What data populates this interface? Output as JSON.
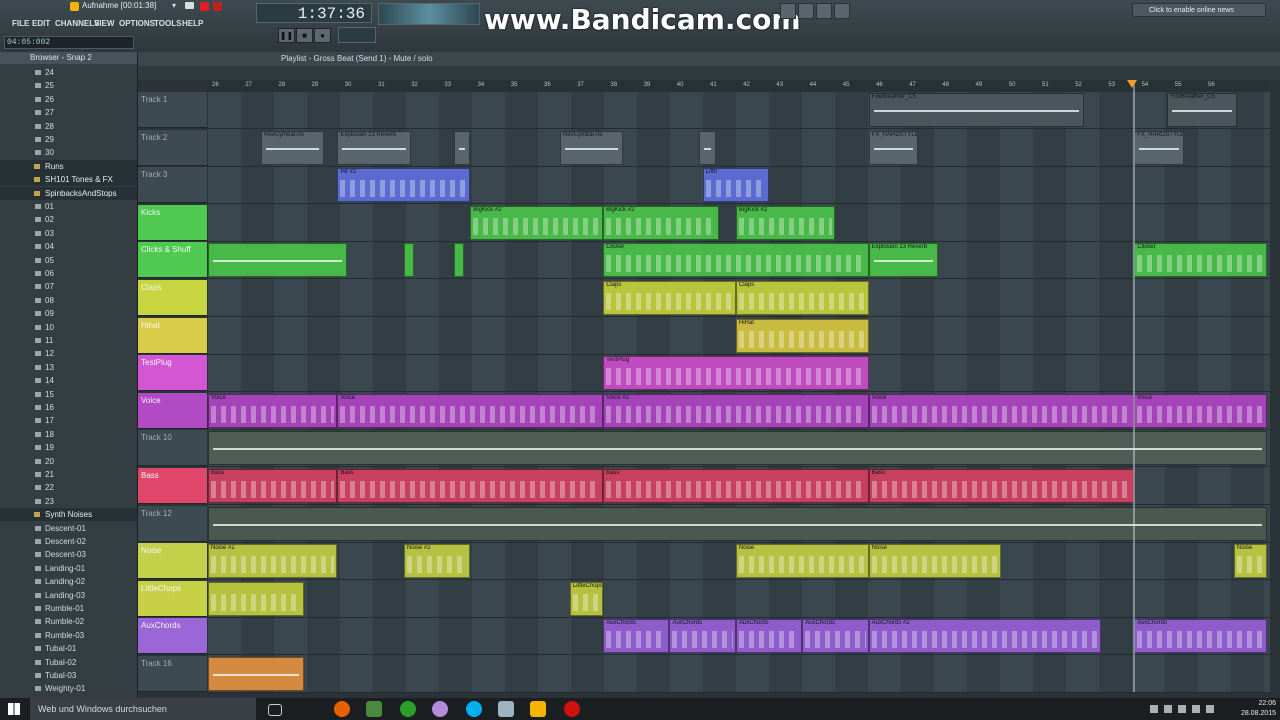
{
  "recording_title": "Aufnahme [00:01:38]",
  "menu": [
    "FILE",
    "EDIT",
    "CHANNELS",
    "VIEW",
    "OPTIONS",
    "TOOLS",
    "HELP"
  ],
  "hint_value": "04:05:002",
  "time_display": "1:37:36",
  "watermark": "www.Bandicam.com",
  "online_news": "Click to enable online news",
  "browser": {
    "title": "Browser - Snap 2",
    "items": [
      {
        "label": "24",
        "folder": false
      },
      {
        "label": "25",
        "folder": false
      },
      {
        "label": "26",
        "folder": false
      },
      {
        "label": "27",
        "folder": false
      },
      {
        "label": "28",
        "folder": false
      },
      {
        "label": "29",
        "folder": false
      },
      {
        "label": "30",
        "folder": false
      },
      {
        "label": "Runs",
        "folder": true
      },
      {
        "label": "SH101 Tones & FX",
        "folder": true
      },
      {
        "label": "SpinbacksAndStops",
        "folder": true
      },
      {
        "label": "01",
        "folder": false
      },
      {
        "label": "02",
        "folder": false
      },
      {
        "label": "03",
        "folder": false
      },
      {
        "label": "04",
        "folder": false
      },
      {
        "label": "05",
        "folder": false
      },
      {
        "label": "06",
        "folder": false
      },
      {
        "label": "07",
        "folder": false
      },
      {
        "label": "08",
        "folder": false
      },
      {
        "label": "09",
        "folder": false
      },
      {
        "label": "10",
        "folder": false
      },
      {
        "label": "11",
        "folder": false
      },
      {
        "label": "12",
        "folder": false
      },
      {
        "label": "13",
        "folder": false
      },
      {
        "label": "14",
        "folder": false
      },
      {
        "label": "15",
        "folder": false
      },
      {
        "label": "16",
        "folder": false
      },
      {
        "label": "17",
        "folder": false
      },
      {
        "label": "18",
        "folder": false
      },
      {
        "label": "19",
        "folder": false
      },
      {
        "label": "20",
        "folder": false
      },
      {
        "label": "21",
        "folder": false
      },
      {
        "label": "22",
        "folder": false
      },
      {
        "label": "23",
        "folder": false
      },
      {
        "label": "Synth Noises",
        "folder": true
      },
      {
        "label": "Descent-01",
        "folder": false
      },
      {
        "label": "Descent-02",
        "folder": false
      },
      {
        "label": "Descent-03",
        "folder": false
      },
      {
        "label": "Landing-01",
        "folder": false
      },
      {
        "label": "Landing-02",
        "folder": false
      },
      {
        "label": "Landing-03",
        "folder": false
      },
      {
        "label": "Rumble-01",
        "folder": false
      },
      {
        "label": "Rumble-02",
        "folder": false
      },
      {
        "label": "Rumble-03",
        "folder": false
      },
      {
        "label": "Tubal-01",
        "folder": false
      },
      {
        "label": "Tubal-02",
        "folder": false
      },
      {
        "label": "Tubal-03",
        "folder": false
      },
      {
        "label": "Weighty-01",
        "folder": false
      }
    ]
  },
  "playlist_title": "Playlist - Gross Beat (Send 1) - Mute / solo",
  "ruler": [
    "26",
    "27",
    "28",
    "29",
    "30",
    "31",
    "32",
    "33",
    "34",
    "35",
    "36",
    "37",
    "38",
    "39",
    "40",
    "41",
    "42",
    "43",
    "44",
    "45",
    "46",
    "47",
    "48",
    "49",
    "50",
    "51",
    "52",
    "53",
    "54",
    "55",
    "56"
  ],
  "tracks": [
    {
      "name": "Track 1",
      "color": "#3d4a51",
      "clips": [
        {
          "s": 19.9,
          "e": 26.4,
          "label": "FireBreather_C5",
          "c": "#4a565c",
          "k": "auto"
        },
        {
          "s": 28.9,
          "e": 31.0,
          "label": "FireBreather_C5",
          "c": "#4a565c",
          "k": "auto"
        }
      ]
    },
    {
      "name": "Track 2",
      "color": "#3d4a51",
      "clips": [
        {
          "s": 1.6,
          "e": 3.5,
          "label": "RevCymbal-05",
          "c": "#59656c",
          "k": "wave"
        },
        {
          "s": 3.9,
          "e": 6.1,
          "label": "Explosion 13 Reverb",
          "c": "#59656c",
          "k": "wave"
        },
        {
          "s": 7.4,
          "e": 7.9,
          "label": "",
          "c": "#59656c",
          "k": "wave"
        },
        {
          "s": 10.6,
          "e": 12.5,
          "label": "RevCymbal-05",
          "c": "#59656c",
          "k": "wave"
        },
        {
          "s": 14.8,
          "e": 15.3,
          "label": "",
          "c": "#59656c",
          "k": "wave"
        },
        {
          "s": 19.9,
          "e": 21.4,
          "label": "FX_HARDSTYLE",
          "c": "#59656c",
          "k": "wave"
        },
        {
          "s": 27.9,
          "e": 29.4,
          "label": "FX_HARDSTYLE",
          "c": "#59656c",
          "k": "wave"
        }
      ]
    },
    {
      "name": "Track 3",
      "color": "#3d4a51",
      "clips": [
        {
          "s": 3.9,
          "e": 7.9,
          "label": "Hit #2",
          "c": "#5b6bcf",
          "k": "notes"
        },
        {
          "s": 14.9,
          "e": 16.9,
          "label": "Liftfr",
          "c": "#5b6bcf",
          "k": "notes"
        }
      ]
    },
    {
      "name": "Kicks",
      "color": "#4fc94f",
      "clips": [
        {
          "s": 7.9,
          "e": 11.9,
          "label": "BigKick #2",
          "c": "#48b848",
          "k": "notes"
        },
        {
          "s": 11.9,
          "e": 15.4,
          "label": "BigKick #2",
          "c": "#48b848",
          "k": "notes"
        },
        {
          "s": 15.9,
          "e": 18.9,
          "label": "BigKick #2",
          "c": "#48b848",
          "k": "notes"
        }
      ]
    },
    {
      "name": "Clicks & Shuff",
      "color": "#4fc94f",
      "clips": [
        {
          "s": 0,
          "e": 4.2,
          "label": "",
          "c": "#48b848",
          "k": "wave"
        },
        {
          "s": 5.9,
          "e": 6.2,
          "label": "",
          "c": "#48b848",
          "k": "wave"
        },
        {
          "s": 7.4,
          "e": 7.7,
          "label": "",
          "c": "#48b848",
          "k": "wave"
        },
        {
          "s": 11.9,
          "e": 19.9,
          "label": "Clicker",
          "c": "#48b848",
          "k": "notes"
        },
        {
          "s": 19.9,
          "e": 22.0,
          "label": "Explosion 13 Reverb",
          "c": "#48b848",
          "k": "wave"
        },
        {
          "s": 27.9,
          "e": 31.9,
          "label": "Clicker",
          "c": "#48b848",
          "k": "notes"
        }
      ]
    },
    {
      "name": "Claps",
      "color": "#c7d541",
      "clips": [
        {
          "s": 11.9,
          "e": 15.9,
          "label": "Claps",
          "c": "#b8c43c",
          "k": "notes"
        },
        {
          "s": 15.9,
          "e": 19.9,
          "label": "Claps",
          "c": "#b8c43c",
          "k": "notes"
        }
      ]
    },
    {
      "name": "Hihat",
      "color": "#d9cc48",
      "clips": [
        {
          "s": 15.9,
          "e": 19.9,
          "label": "HiHat",
          "c": "#c8bb40",
          "k": "notes"
        }
      ]
    },
    {
      "name": "TestPlug",
      "color": "#d356d3",
      "clips": [
        {
          "s": 11.9,
          "e": 19.9,
          "label": "TestPlug",
          "c": "#bf4cbf",
          "k": "notes"
        }
      ]
    },
    {
      "name": "Voice",
      "color": "#b24ac6",
      "clips": [
        {
          "s": 0,
          "e": 3.9,
          "label": "Voice",
          "c": "#a444b8",
          "k": "notes"
        },
        {
          "s": 3.9,
          "e": 11.9,
          "label": "Voice",
          "c": "#a444b8",
          "k": "notes"
        },
        {
          "s": 11.9,
          "e": 19.9,
          "label": "Voice #2",
          "c": "#a444b8",
          "k": "notes"
        },
        {
          "s": 19.9,
          "e": 27.9,
          "label": "Voice",
          "c": "#a444b8",
          "k": "notes"
        },
        {
          "s": 27.9,
          "e": 31.9,
          "label": "Voice",
          "c": "#a444b8",
          "k": "notes"
        }
      ]
    },
    {
      "name": "Track 10",
      "color": "#3d4a51",
      "clips": [
        {
          "s": 0,
          "e": 31.9,
          "label": "",
          "c": "#4e5c55",
          "k": "auto"
        }
      ]
    },
    {
      "name": "Bass",
      "color": "#e0476a",
      "clips": [
        {
          "s": 0,
          "e": 3.9,
          "label": "Bass",
          "c": "#c8405f",
          "k": "notes"
        },
        {
          "s": 3.9,
          "e": 11.9,
          "label": "Bass",
          "c": "#c8405f",
          "k": "notes"
        },
        {
          "s": 11.9,
          "e": 19.9,
          "label": "Bass",
          "c": "#c8405f",
          "k": "notes"
        },
        {
          "s": 19.9,
          "e": 27.9,
          "label": "Bass",
          "c": "#c8405f",
          "k": "notes"
        }
      ]
    },
    {
      "name": "Track 12",
      "color": "#3d4a51",
      "clips": [
        {
          "s": 0,
          "e": 31.9,
          "label": "",
          "c": "#4a5850",
          "k": "auto"
        }
      ]
    },
    {
      "name": "Noise",
      "color": "#c3d14a",
      "clips": [
        {
          "s": 0,
          "e": 3.9,
          "label": "Noise #2",
          "c": "#b4c142",
          "k": "notes"
        },
        {
          "s": 5.9,
          "e": 7.9,
          "label": "Noise #2",
          "c": "#b4c142",
          "k": "notes"
        },
        {
          "s": 15.9,
          "e": 19.9,
          "label": "Noise",
          "c": "#b4c142",
          "k": "notes"
        },
        {
          "s": 19.9,
          "e": 23.9,
          "label": "Noise",
          "c": "#b4c142",
          "k": "notes"
        },
        {
          "s": 30.9,
          "e": 31.9,
          "label": "Noise",
          "c": "#b4c142",
          "k": "notes"
        }
      ]
    },
    {
      "name": "LittleChops",
      "color": "#c8d146",
      "clips": [
        {
          "s": 0,
          "e": 2.9,
          "label": "",
          "c": "#b7c140",
          "k": "notes"
        },
        {
          "s": 10.9,
          "e": 11.9,
          "label": "LittleChops",
          "c": "#b7c140",
          "k": "notes"
        }
      ]
    },
    {
      "name": "AuxChords",
      "color": "#9b66d6",
      "clips": [
        {
          "s": 11.9,
          "e": 13.9,
          "label": "AuxChords",
          "c": "#8e5ccb",
          "k": "notes"
        },
        {
          "s": 13.9,
          "e": 15.9,
          "label": "AuxChords",
          "c": "#8e5ccb",
          "k": "notes"
        },
        {
          "s": 15.9,
          "e": 17.9,
          "label": "AuxChords",
          "c": "#8e5ccb",
          "k": "notes"
        },
        {
          "s": 17.9,
          "e": 19.9,
          "label": "AuxChords",
          "c": "#8e5ccb",
          "k": "notes"
        },
        {
          "s": 19.9,
          "e": 26.9,
          "label": "AuxChords #2",
          "c": "#8e5ccb",
          "k": "notes"
        },
        {
          "s": 27.9,
          "e": 31.9,
          "label": "AuxChords",
          "c": "#8e5ccb",
          "k": "notes"
        }
      ]
    },
    {
      "name": "Track 16",
      "color": "#3d4a51",
      "clips": [
        {
          "s": 0,
          "e": 2.9,
          "label": "",
          "c": "#d38a3e",
          "k": "auto"
        }
      ]
    }
  ],
  "taskbar": {
    "search": "Web und Windows durchsuchen",
    "time": "22:06",
    "date": "28.08.2015"
  }
}
